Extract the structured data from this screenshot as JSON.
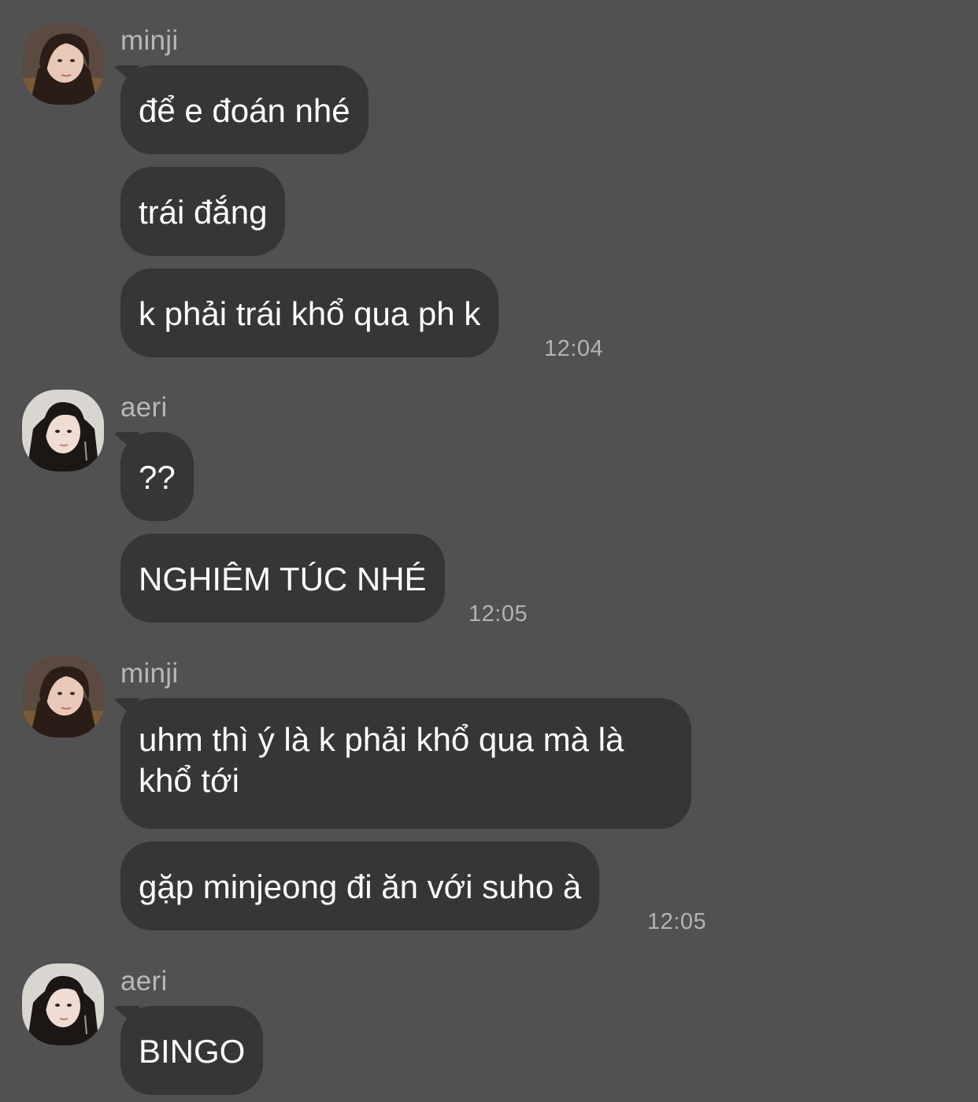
{
  "colors": {
    "background": "#525152",
    "bubble": "#363537",
    "text": "#ffffff",
    "meta_text": "#b4b3b4"
  },
  "groups": [
    {
      "sender": "minji",
      "avatar": "avatar-minji",
      "messages": [
        "để e đoán nhé",
        "trái đắng",
        "k phải trái khổ qua ph k"
      ],
      "time": "12:04"
    },
    {
      "sender": "aeri",
      "avatar": "avatar-aeri",
      "messages": [
        "??",
        "NGHIÊM TÚC NHÉ"
      ],
      "time": "12:05"
    },
    {
      "sender": "minji",
      "avatar": "avatar-minji",
      "messages": [
        "uhm thì ý là k phải khổ qua mà là khổ tới",
        "gặp minjeong đi ăn với suho à"
      ],
      "time": "12:05"
    },
    {
      "sender": "aeri",
      "avatar": "avatar-aeri",
      "messages": [
        "BINGO"
      ]
    }
  ]
}
